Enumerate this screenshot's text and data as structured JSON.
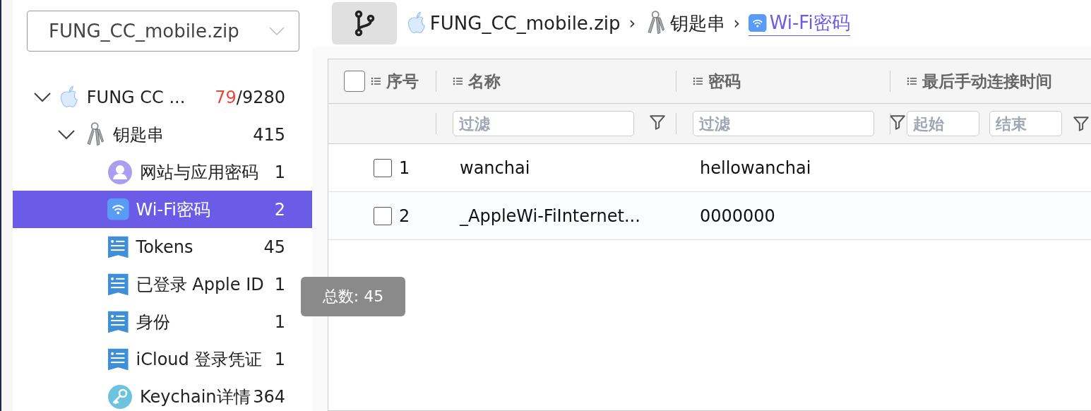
{
  "sidebar": {
    "source_select": {
      "value": "FUNG_CC_mobile.zip"
    },
    "tree": [
      {
        "label": "FUNG CC ...",
        "kind": "apple",
        "count_parts": [
          {
            "text": "79",
            "highlight": true
          },
          {
            "text": "/9280",
            "highlight": false
          }
        ],
        "expanded": true,
        "selected": false,
        "children": [
          {
            "label": "钥匙串",
            "kind": "keys",
            "count": "415",
            "expanded": true,
            "selected": false,
            "children": [
              {
                "label": "网站与应用密码",
                "kind": "person",
                "count": "1",
                "selected": false
              },
              {
                "label": "Wi-Fi密码",
                "kind": "wifi",
                "count": "2",
                "selected": true
              },
              {
                "label": "Tokens",
                "kind": "list",
                "count": "45",
                "selected": false
              },
              {
                "label": "已登录 Apple ID",
                "kind": "list",
                "count": "1",
                "selected": false
              },
              {
                "label": "身份",
                "kind": "list",
                "count": "1",
                "selected": false
              },
              {
                "label": "iCloud 登录凭证",
                "kind": "list",
                "count": "1",
                "selected": false
              },
              {
                "label": "Keychain详情",
                "kind": "key",
                "count": "364",
                "selected": false
              }
            ]
          }
        ]
      }
    ],
    "tooltip": "总数: 45"
  },
  "breadcrumb": [
    {
      "label": "FUNG_CC_mobile.zip",
      "kind": "apple",
      "selected": false
    },
    {
      "separator": "›",
      "label": "钥匙串",
      "kind": "keys",
      "selected": false
    },
    {
      "separator": "›",
      "label": "Wi-Fi密码",
      "kind": "wifi",
      "selected": true
    }
  ],
  "table": {
    "columns": [
      {
        "label": "序号",
        "kind": "plain"
      },
      {
        "label": "名称",
        "kind": "text",
        "placeholder": "过滤"
      },
      {
        "label": "密码",
        "kind": "text",
        "placeholder": "过滤"
      },
      {
        "label": "最后手动连接时间",
        "kind": "range",
        "placeholders": [
          "起始",
          "结束"
        ]
      }
    ],
    "select_all": {
      "checked": false
    },
    "rows": [
      {
        "checked": false,
        "cells": [
          "1",
          "wanchai",
          "hellowanchai",
          ""
        ]
      },
      {
        "checked": false,
        "cells": [
          "2",
          "_AppleWi-FiInternet...",
          "0000000",
          ""
        ]
      }
    ]
  }
}
